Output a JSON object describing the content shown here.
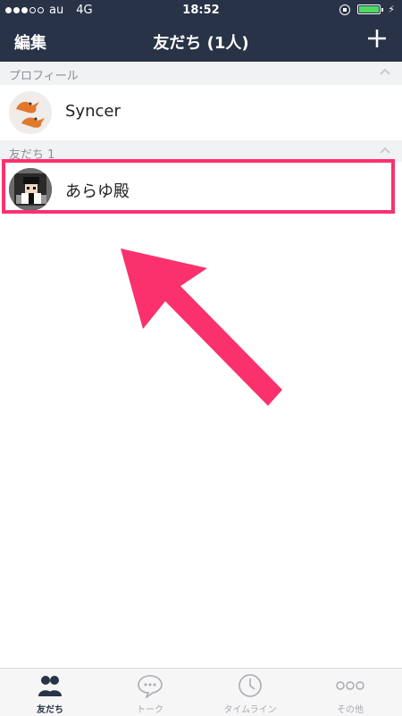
{
  "status_bar": {
    "carrier": "au",
    "network": "4G",
    "time": "18:52",
    "battery_percent": 100
  },
  "nav": {
    "edit_label": "編集",
    "title": "友だち (1人)",
    "add_icon": "plus-icon"
  },
  "sections": {
    "profile": {
      "label": "プロフィール"
    },
    "friends": {
      "label": "友だち 1"
    }
  },
  "profile": {
    "name": "Syncer",
    "avatar": "orange-bird-avatar"
  },
  "friends": [
    {
      "name": "あらゆ殿",
      "avatar": "pixel-character-avatar"
    }
  ],
  "tabs": [
    {
      "label": "友だち",
      "icon": "friends-icon",
      "active": true
    },
    {
      "label": "トーク",
      "icon": "chat-bubble-icon",
      "active": false
    },
    {
      "label": "タイムライン",
      "icon": "clock-icon",
      "active": false
    },
    {
      "label": "その他",
      "icon": "more-dots-icon",
      "active": false
    }
  ],
  "colors": {
    "nav_bg": "#283347",
    "highlight": "#fb316e",
    "section_bg": "#f1f2f4"
  }
}
